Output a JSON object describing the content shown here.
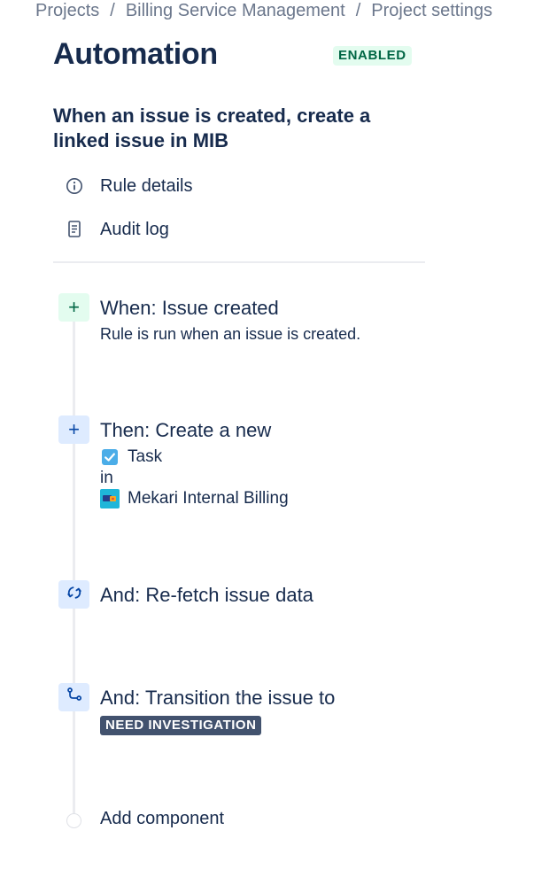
{
  "breadcrumb": {
    "items": [
      "Projects",
      "Billing Service Management",
      "Project settings"
    ],
    "separator": "/"
  },
  "header": {
    "title": "Automation",
    "status": "ENABLED"
  },
  "rule": {
    "name": "When an issue is created, create a linked issue in MIB"
  },
  "nav": {
    "rule_details": "Rule details",
    "audit_log": "Audit log"
  },
  "steps": {
    "trigger": {
      "icon": "plus-icon",
      "title": "When: Issue created",
      "description": "Rule is run when an issue is created."
    },
    "create": {
      "icon": "plus-icon",
      "title": "Then: Create a new",
      "issue_type": "Task",
      "connector": "in",
      "project": "Mekari Internal Billing"
    },
    "refetch": {
      "icon": "refresh-icon",
      "title": "And: Re-fetch issue data"
    },
    "transition": {
      "icon": "transition-icon",
      "title": "And: Transition the issue to",
      "status": "NEED INVESTIGATION"
    }
  },
  "add_component": "Add component",
  "colors": {
    "text": "#172b4d",
    "muted": "#6b778c",
    "enabled_bg": "#e3fcef",
    "enabled_text": "#006644",
    "step_blue_bg": "#deebff",
    "status_pill_bg": "#42526e",
    "task_icon": "#4bade8"
  }
}
